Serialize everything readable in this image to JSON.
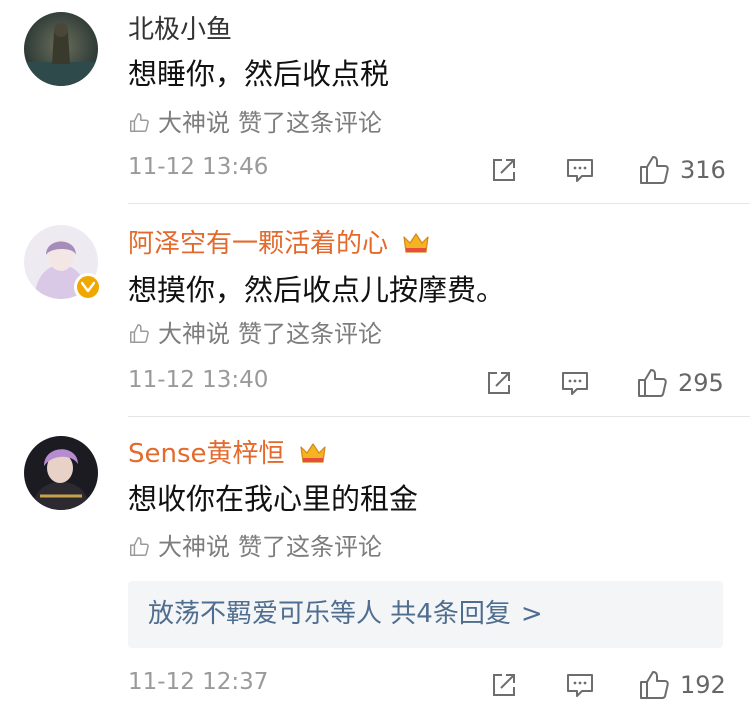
{
  "comments": [
    {
      "name": "北极小鱼",
      "text": "想睡你，然后收点税",
      "liked_by": "大神说",
      "liked_suffix": "赞了这条评论",
      "time": "11-12 13:46",
      "likes": "316",
      "vip": false
    },
    {
      "name": "阿泽空有一颗活着的心",
      "text": "想摸你，然后收点儿按摩费。",
      "liked_by": "大神说",
      "liked_suffix": "赞了这条评论",
      "time": "11-12 13:40",
      "likes": "295",
      "vip": true
    },
    {
      "name": "Sense黄梓恒",
      "text": "想收你在我心里的租金",
      "liked_by": "大神说",
      "liked_suffix": "赞了这条评论",
      "replies_text": "放荡不羁爱可乐等人",
      "replies_count": "共4条回复",
      "replies_arrow": ">",
      "time": "11-12 12:37",
      "likes": "192",
      "vip": true
    }
  ],
  "colors": {
    "vip_name": "#e36a2c",
    "link": "#4f6d8f",
    "meta": "#9a9a9a",
    "verified": "#f0a800"
  },
  "icons": [
    "share-icon",
    "comment-icon",
    "thumbs-up-icon",
    "crown-icon",
    "verified-badge-icon"
  ]
}
